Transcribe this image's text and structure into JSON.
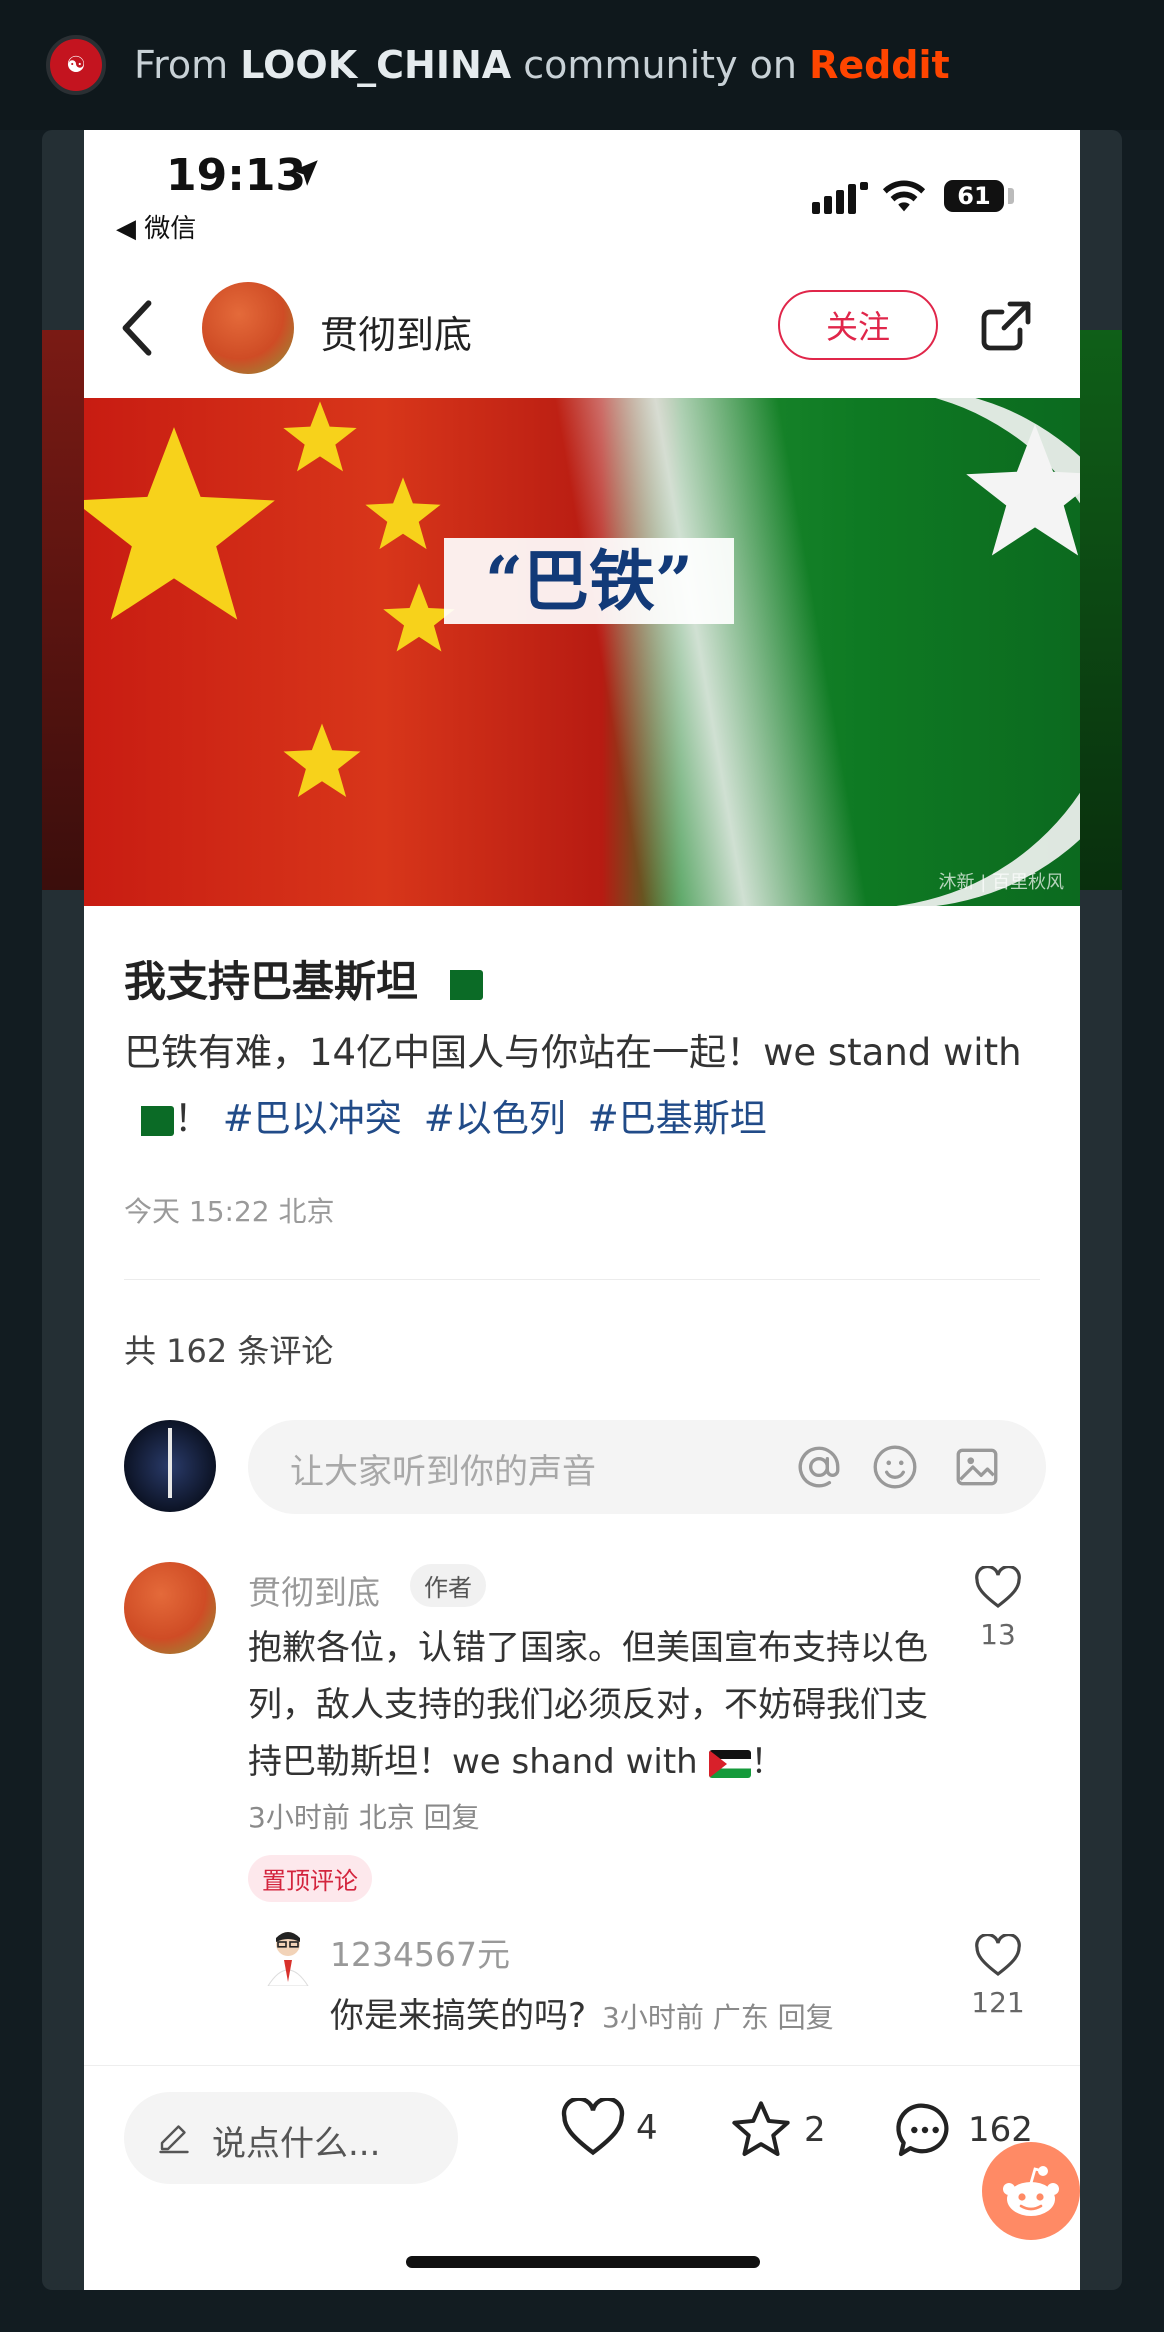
{
  "banner": {
    "prefix": "From ",
    "community": "LOOK_CHINA",
    "middle": " community on ",
    "platform": "Reddit"
  },
  "status_bar": {
    "time": "19:13",
    "back_app": "◀ 微信",
    "battery": "61"
  },
  "header": {
    "author": "贯彻到底",
    "follow_label": "关注"
  },
  "hero": {
    "label": "“巴铁”",
    "watermark": "沐新 | 百里秋风"
  },
  "post": {
    "title": "我支持巴基斯坦",
    "body_prefix": "巴铁有难，14亿中国人与你站在一起！we stand with ",
    "body_suffix": "！ ",
    "hashtags": [
      "#巴以冲突",
      "#以色列",
      "#巴基斯坦"
    ],
    "meta": "今天 15:22 北京"
  },
  "comments_section": {
    "count_label": "共 162 条评论",
    "input_placeholder": "让大家听到你的声音"
  },
  "comment1": {
    "author": "贯彻到底",
    "author_tag": "作者",
    "text_prefix": "抱歉各位，认错了国家。但美国宣布支持以色列，敌人支持的我们必须反对，不妨碍我们支持巴勒斯坦！we shand with ",
    "text_suffix": "！",
    "meta": "3小时前 北京 回复",
    "pinned_label": "置顶评论",
    "likes": "13"
  },
  "reply1": {
    "author": "1234567元",
    "text": "你是来搞笑的吗?",
    "meta": "3小时前 广东 回复",
    "likes": "121"
  },
  "bottom_bar": {
    "say_placeholder": "说点什么...",
    "likes": "4",
    "stars": "2",
    "comments": "162"
  },
  "colors": {
    "follow_accent": "#e0264a",
    "hashtag": "#214b88",
    "reddit_orange": "#ff4500"
  }
}
